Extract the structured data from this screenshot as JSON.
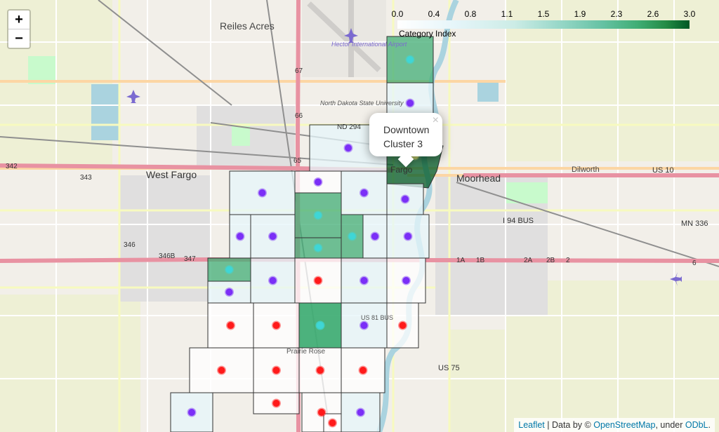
{
  "zoom": {
    "in_label": "+",
    "out_label": "−"
  },
  "legend": {
    "ticks": [
      "0.0",
      "0.4",
      "0.8",
      "1.1",
      "1.5",
      "1.9",
      "2.3",
      "2.6",
      "3.0"
    ],
    "caption": "Category Index"
  },
  "popup": {
    "line1": "Downtown",
    "line2": "Cluster 3",
    "close": "×"
  },
  "attribution": {
    "leaflet": "Leaflet",
    "sep1": " | Data by © ",
    "osm": "OpenStreetMap",
    "sep2": ", under ",
    "odbl": "ODbL",
    "end": "."
  },
  "map_labels": {
    "reiles_acres": "Reiles Acres",
    "west_fargo": "West Fargo",
    "moorhead": "Moorhead",
    "dilworth": "Dilworth",
    "fargo": "Fargo",
    "airport": "Hector International Airport",
    "ndsu": "North Dakota State University",
    "prairie_rose": "Prairie Rose",
    "nd294": "ND 294",
    "us10": "US 10",
    "i94bus": "I 94 BUS",
    "mn336": "MN 336",
    "us75": "US 75",
    "us81bus": "US 81 BUS",
    "r342": "342",
    "r343": "343",
    "r346": "346",
    "r346b": "346B",
    "r347": "347",
    "r65": "65",
    "r66": "66",
    "r67": "67",
    "r1a": "1A",
    "r1b": "1B",
    "r2a": "2A",
    "r2b": "2B",
    "r2": "2",
    "r6": "6"
  },
  "colors": {
    "purple": "#7b2ff7",
    "cyan": "#3fd6d6",
    "red": "#ff1a1a",
    "olive": "#b7c46a"
  },
  "map_data": {
    "choropleth_scale": {
      "min": 0.0,
      "max": 3.0
    },
    "cells": [
      {
        "cluster": 1,
        "index": 2.2
      },
      {
        "cluster": 0,
        "index": 0.3
      },
      {
        "cluster": 0,
        "index": 0.3
      },
      {
        "cluster": 0,
        "index": 0.3
      },
      {
        "cluster": 3,
        "index": 3.0
      },
      {
        "cluster": 0,
        "index": 0.3
      },
      {
        "cluster": 0,
        "index": 0.3
      },
      {
        "cluster": 0,
        "index": 0.2
      },
      {
        "cluster": 1,
        "index": 2.1
      },
      {
        "cluster": 1,
        "index": 2.0
      },
      {
        "cluster": 0,
        "index": 0.3
      },
      {
        "cluster": 0,
        "index": 0.3
      },
      {
        "cluster": 1,
        "index": 2.0
      },
      {
        "cluster": 0,
        "index": 0.3
      },
      {
        "cluster": 0,
        "index": 0.3
      },
      {
        "cluster": 0,
        "index": 0.3
      },
      {
        "cluster": 1,
        "index": 2.0
      },
      {
        "cluster": 2,
        "index": 0.0
      },
      {
        "cluster": 0,
        "index": 0.3
      },
      {
        "cluster": 0,
        "index": 0.2
      },
      {
        "cluster": 1,
        "index": 2.0
      },
      {
        "cluster": 0,
        "index": 0.3
      },
      {
        "cluster": 2,
        "index": 0.0
      },
      {
        "cluster": 1,
        "index": 2.0
      },
      {
        "cluster": 0,
        "index": 0.3
      },
      {
        "cluster": 2,
        "index": 0.0
      },
      {
        "cluster": 2,
        "index": 0.0
      },
      {
        "cluster": 2,
        "index": 0.0
      },
      {
        "cluster": 2,
        "index": 0.0
      },
      {
        "cluster": 2,
        "index": 0.0
      },
      {
        "cluster": 2,
        "index": 0.0
      },
      {
        "cluster": 0,
        "index": 0.3
      },
      {
        "cluster": 2,
        "index": 0.0
      },
      {
        "cluster": 2,
        "index": 0.0
      },
      {
        "cluster": 2,
        "index": 0.0
      },
      {
        "cluster": 0,
        "index": 0.3
      }
    ]
  }
}
